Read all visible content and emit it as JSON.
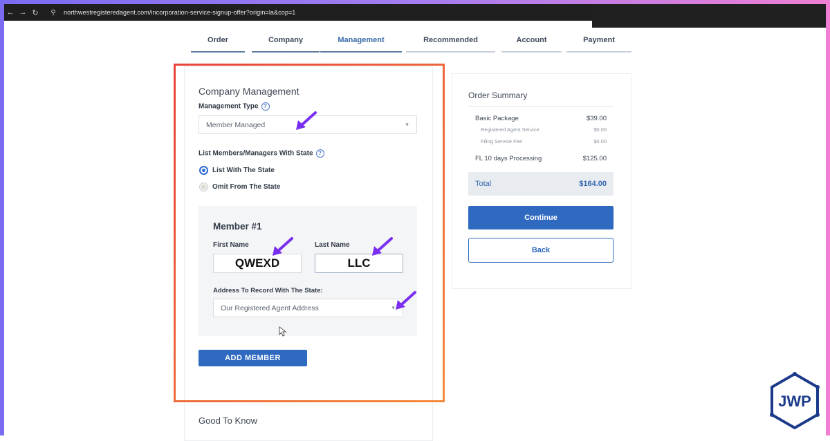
{
  "browser": {
    "url": "northwestregisteredagent.com/incorporation-service-signup-offer?origin=la&cop=1"
  },
  "steps": [
    {
      "label": "Order",
      "state": "done"
    },
    {
      "label": "Company",
      "state": "done"
    },
    {
      "label": "Management",
      "state": "active"
    },
    {
      "label": "Recommended",
      "state": "todo"
    },
    {
      "label": "Account",
      "state": "todo"
    },
    {
      "label": "Payment",
      "state": "todo"
    }
  ],
  "management": {
    "title": "Company Management",
    "type_label": "Management Type",
    "type_value": "Member Managed",
    "list_label": "List Members/Managers With State",
    "radio_list": "List With The State",
    "radio_omit": "Omit From The State",
    "selected_radio": "List With The State"
  },
  "member": {
    "title": "Member #1",
    "first_name_label": "First Name",
    "first_name_value": "QWEXD",
    "last_name_label": "Last Name",
    "last_name_value": "LLC",
    "address_label": "Address To Record With The State:",
    "address_value": "Our Registered Agent Address"
  },
  "add_member_label": "ADD MEMBER",
  "good_to_know": "Good To Know",
  "summary": {
    "title": "Order Summary",
    "basic_label": "Basic Package",
    "basic_price": "$39.00",
    "ra_label": "Registered Agent Service",
    "ra_price": "$0.00",
    "filing_label": "Filing Service Fee",
    "filing_price": "$0.00",
    "fl_label": "FL 10 days Processing",
    "fl_price": "$125.00",
    "total_label": "Total",
    "total_value": "$164.00",
    "continue_label": "Continue",
    "back_label": "Back"
  },
  "colors": {
    "primary_blue": "#2f69c0",
    "highlight_box": "#ee5a3a",
    "annotation_arrow": "#7a2ff0"
  },
  "logo_text": "JWP"
}
